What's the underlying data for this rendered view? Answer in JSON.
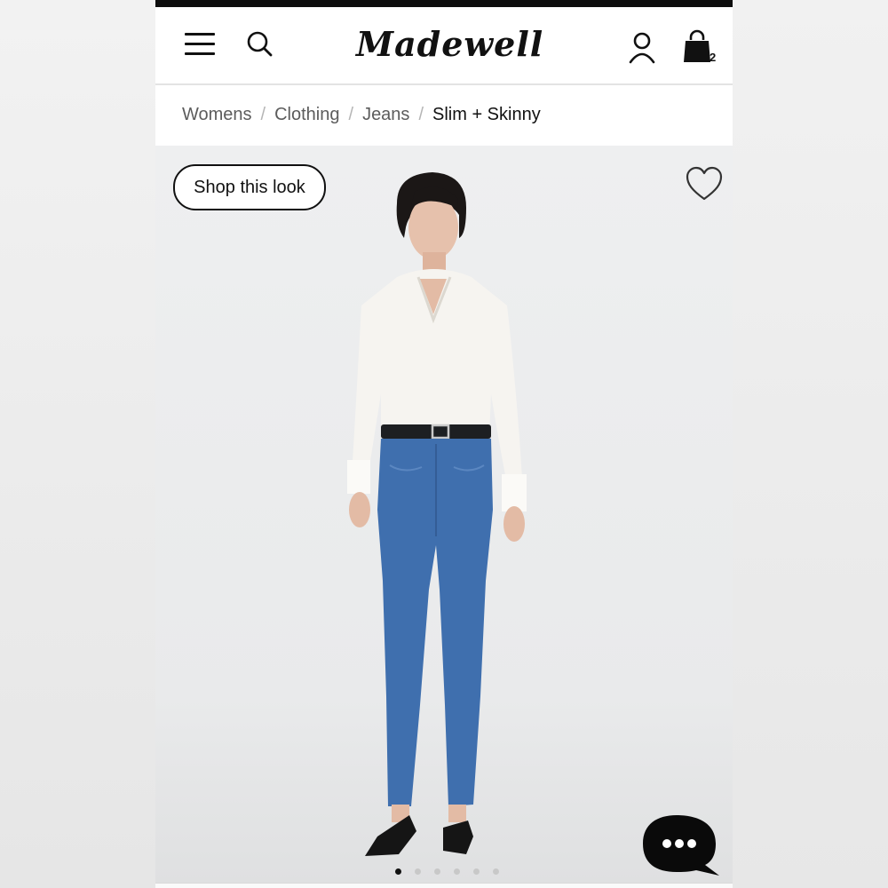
{
  "brand": {
    "logo_text": "Madewell"
  },
  "header": {
    "cart_count": "2",
    "icons": [
      "menu-icon",
      "search-icon",
      "account-icon",
      "bag-icon"
    ]
  },
  "breadcrumb": {
    "items": [
      "Womens",
      "Clothing",
      "Jeans"
    ],
    "current": "Slim + Skinny",
    "separator": "/"
  },
  "product_image": {
    "shop_look_label": "Shop this look",
    "gallery_count": 6,
    "active_index": 0
  },
  "colors": {
    "text": "#111111",
    "background": "#ffffff",
    "denim": "#3f6fae",
    "hero_background": "#eceded"
  }
}
